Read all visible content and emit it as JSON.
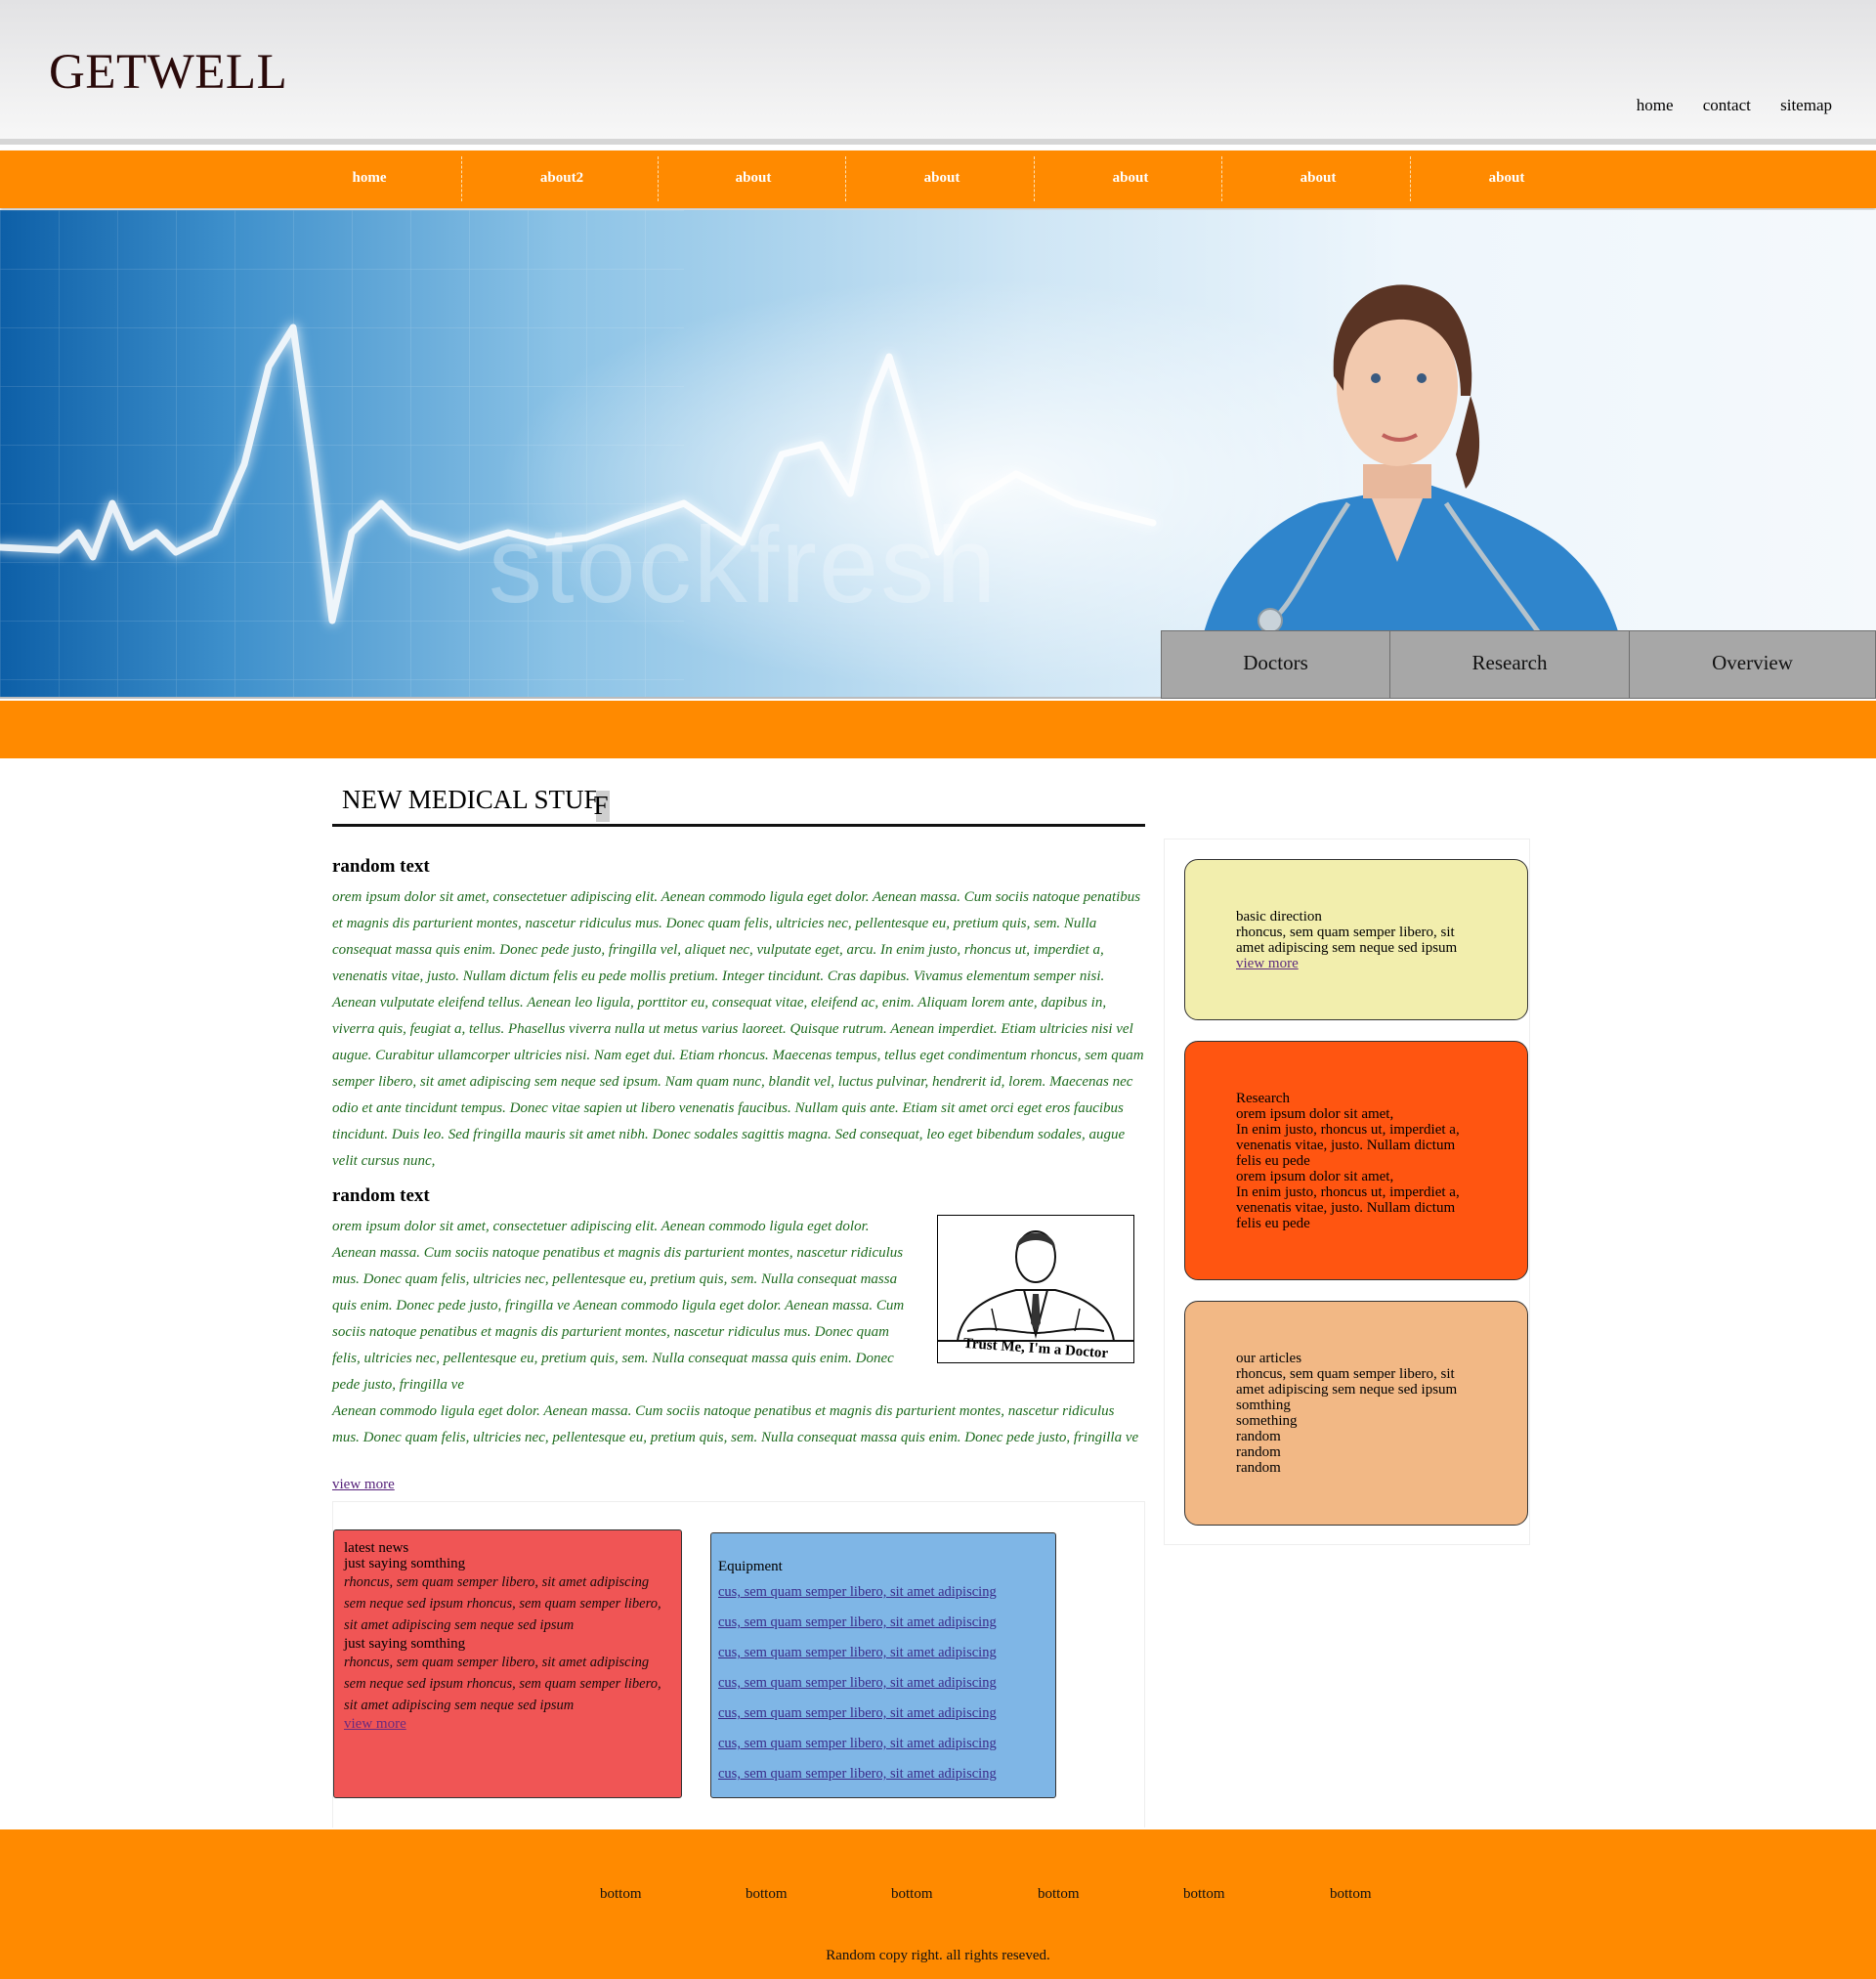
{
  "header": {
    "logo": "GETWELL",
    "top_links": [
      "home",
      "contact",
      "sitemap"
    ]
  },
  "nav": {
    "items": [
      "home",
      "about2",
      "about",
      "about",
      "about",
      "about",
      "about"
    ]
  },
  "hero": {
    "watermark": "stockfresh",
    "tabs": [
      "Doctors",
      "Research",
      "Overview"
    ]
  },
  "main": {
    "title": "NEW MEDICAL STUF",
    "title_last_char": "F",
    "section1_heading": "random text",
    "section1_text": "orem ipsum dolor sit amet, consectetuer adipiscing elit. Aenean commodo ligula eget dolor. Aenean massa. Cum sociis natoque penatibus et magnis dis parturient montes, nascetur ridiculus mus. Donec quam felis, ultricies nec, pellentesque eu, pretium quis, sem. Nulla consequat massa quis enim. Donec pede justo, fringilla vel, aliquet nec, vulputate eget, arcu. In enim justo, rhoncus ut, imperdiet a, venenatis vitae, justo. Nullam dictum felis eu pede mollis pretium. Integer tincidunt. Cras dapibus. Vivamus elementum semper nisi. Aenean vulputate eleifend tellus. Aenean leo ligula, porttitor eu, consequat vitae, eleifend ac, enim. Aliquam lorem ante, dapibus in, viverra quis, feugiat a, tellus. Phasellus viverra nulla ut metus varius laoreet. Quisque rutrum. Aenean imperdiet. Etiam ultricies nisi vel augue. Curabitur ullamcorper ultricies nisi. Nam eget dui. Etiam rhoncus. Maecenas tempus, tellus eget condimentum rhoncus, sem quam semper libero, sit amet adipiscing sem neque sed ipsum. Nam quam nunc, blandit vel, luctus pulvinar, hendrerit id, lorem. Maecenas nec odio et ante tincidunt tempus. Donec vitae sapien ut libero venenatis faucibus. Nullam quis ante. Etiam sit amet orci eget eros faucibus tincidunt. Duis leo. Sed fringilla mauris sit amet nibh. Donec sodales sagittis magna. Sed consequat, leo eget bibendum sodales, augue velit cursus nunc,",
    "section2_heading": "random text",
    "section2_text": "orem ipsum dolor sit amet, consectetuer adipiscing elit. Aenean commodo ligula eget dolor. Aenean massa. Cum sociis natoque penatibus et magnis dis parturient montes, nascetur ridiculus mus. Donec quam felis, ultricies nec, pellentesque eu, pretium quis, sem. Nulla consequat massa quis enim. Donec pede justo, fringilla ve Aenean commodo ligula eget dolor. Aenean massa. Cum sociis natoque penatibus et magnis dis parturient montes, nascetur ridiculus mus. Donec quam felis, ultricies nec, pellentesque eu, pretium quis, sem. Nulla consequat massa quis enim. Donec pede justo, fringilla ve",
    "section2_text_cont": "Aenean commodo ligula eget dolor. Aenean massa. Cum sociis natoque penatibus et magnis dis parturient montes, nascetur ridiculus mus. Donec quam felis, ultricies nec, pellentesque eu, pretium quis, sem. Nulla consequat massa quis enim. Donec pede justo, fringilla ve",
    "image_caption": "Trust Me, I'm a Doctor",
    "view_more": "view more"
  },
  "news": {
    "title": "latest news",
    "items": [
      {
        "heading": "just saying somthing",
        "text": "rhoncus, sem quam semper libero, sit amet adipiscing sem neque sed ipsum rhoncus, sem quam semper libero, sit amet adipiscing sem neque sed ipsum"
      },
      {
        "heading": "just saying somthing",
        "text": "rhoncus, sem quam semper libero, sit amet adipiscing sem neque sed ipsum rhoncus, sem quam semper libero, sit amet adipiscing sem neque sed ipsum"
      }
    ],
    "view_more": "view more"
  },
  "equipment": {
    "title": "Equipment",
    "links": [
      "cus, sem quam semper libero, sit amet adipiscing",
      "cus, sem quam semper libero, sit amet adipiscing",
      "cus, sem quam semper libero, sit amet adipiscing",
      "cus, sem quam semper libero, sit amet adipiscing",
      "cus, sem quam semper libero, sit amet adipiscing",
      "cus, sem quam semper libero, sit amet adipiscing",
      "cus, sem quam semper libero, sit amet adipiscing"
    ]
  },
  "sidebar": {
    "box1": {
      "title": "basic direction",
      "text": "rhoncus, sem quam semper libero, sit amet adipiscing sem neque sed ipsum",
      "link": "view more"
    },
    "box2": {
      "title": "Research",
      "lines": [
        "orem ipsum dolor sit amet,",
        "In enim justo, rhoncus ut, imperdiet a, venenatis vitae, justo. Nullam dictum felis eu pede",
        "orem ipsum dolor sit amet,",
        "In enim justo, rhoncus ut, imperdiet a, venenatis vitae, justo. Nullam dictum felis eu pede"
      ]
    },
    "box3": {
      "title": "our articles",
      "text": "rhoncus, sem quam semper libero, sit amet adipiscing sem neque sed ipsum",
      "lines": [
        "somthing",
        "something",
        "random",
        "random",
        "random"
      ]
    }
  },
  "footer": {
    "links": [
      "bottom",
      "bottom",
      "bottom",
      "bottom",
      "bottom",
      "bottom"
    ],
    "copyright": "Random copy right. all rights reseved."
  },
  "colors": {
    "orange": "#ff8a00",
    "news_red": "#f05555",
    "equipment_blue": "#7fb6e6",
    "side_yellow": "#f2eead",
    "side_orange": "#ff5511",
    "side_peach": "#f2b885",
    "body_green": "#1e6b1e"
  }
}
